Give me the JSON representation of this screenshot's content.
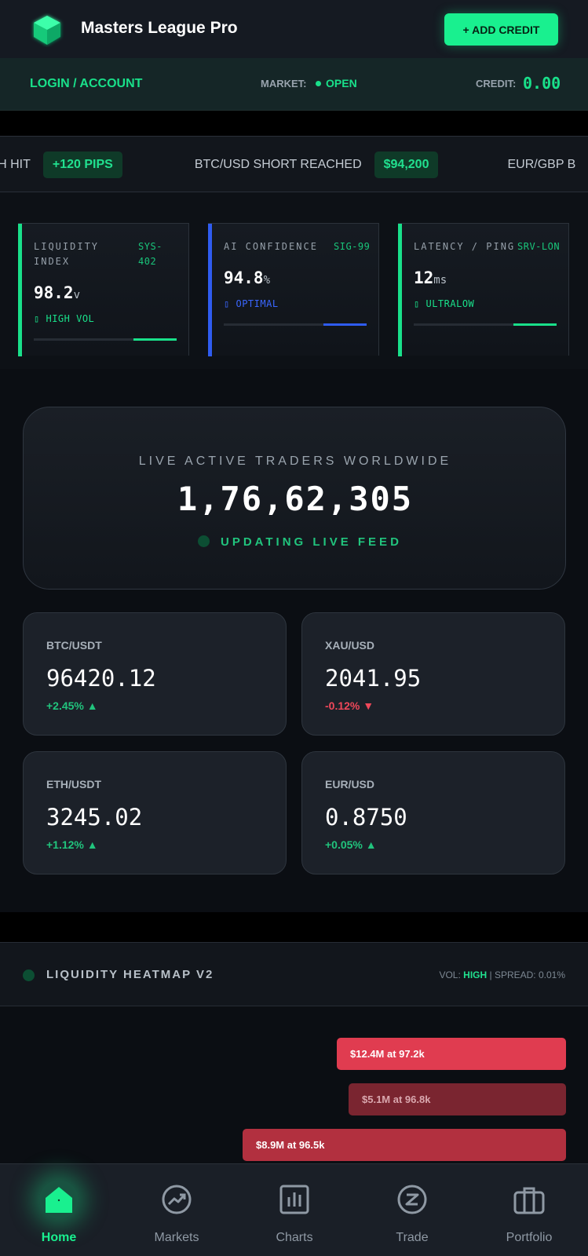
{
  "header": {
    "title": "Masters League Pro",
    "add_credit_label": "+ ADD CREDIT",
    "logo_icon": "cube-icon",
    "brand_color": "#19f08f"
  },
  "subbar": {
    "login_label": "LOGIN / ACCOUNT",
    "market_label": "MARKET:",
    "market_status": "OPEN",
    "credit_label": "CREDIT:",
    "credit_value": "0.00"
  },
  "ticker": {
    "items": [
      {
        "text": "ISH HIT",
        "badge": "+120 PIPS"
      },
      {
        "text": "BTC/USD SHORT REACHED",
        "badge": "$94,200"
      },
      {
        "text": "EUR/GBP B",
        "badge": ""
      }
    ]
  },
  "stats": [
    {
      "label": "LIQUIDITY INDEX",
      "code": "SYS-402",
      "value": "98.2",
      "unit": "v",
      "status": "HIGH VOL",
      "status_icon": "signal-icon",
      "level": 0.3,
      "accent": "#19e08a"
    },
    {
      "label": "AI CONFIDENCE",
      "code": "SIG-99",
      "value": "94.8",
      "unit": "%",
      "status": "OPTIMAL",
      "status_icon": "signal-icon",
      "level": 0.3,
      "accent": "#2f5cf0"
    },
    {
      "label": "LATENCY / PING",
      "code": "SRV-LON",
      "value": "12",
      "unit": "ms",
      "status": "ULTRALOW",
      "status_icon": "signal-icon",
      "level": 0.3,
      "accent": "#19e08a"
    }
  ],
  "traders": {
    "label": "LIVE ACTIVE TRADERS WORLDWIDE",
    "value": "1,76,62,305",
    "status": "UPDATING LIVE FEED"
  },
  "prices": [
    {
      "pair": "BTC/USDT",
      "price": "96420.12",
      "change": "+2.45% ▲",
      "direction": "up"
    },
    {
      "pair": "XAU/USD",
      "price": "2041.95",
      "change": "-0.12% ▼",
      "direction": "down"
    },
    {
      "pair": "ETH/USDT",
      "price": "3245.02",
      "change": "+1.12% ▲",
      "direction": "up"
    },
    {
      "pair": "EUR/USD",
      "price": "0.8750",
      "change": "+0.05% ▲",
      "direction": "up"
    }
  ],
  "heatmap": {
    "title": "LIQUIDITY HEATMAP V2",
    "vol_label": "VOL:",
    "vol_value": "HIGH",
    "spread_label": "| SPREAD: 0.01%",
    "bars": [
      {
        "label": "$12.4M at 97.2k",
        "amount_m": 12.4,
        "color": "#e03c50"
      },
      {
        "label": "$5.1M at 96.8k",
        "amount_m": 5.1,
        "color": "#7a2530"
      },
      {
        "label": "$8.9M at 96.5k",
        "amount_m": 8.9,
        "color": "#b2303f"
      }
    ]
  },
  "nav": {
    "items": [
      {
        "label": "Home",
        "icon": "home-icon",
        "active": true
      },
      {
        "label": "Markets",
        "icon": "trending-icon",
        "active": false
      },
      {
        "label": "Charts",
        "icon": "bar-chart-icon",
        "active": false
      },
      {
        "label": "Trade",
        "icon": "exchange-icon",
        "active": false
      },
      {
        "label": "Portfolio",
        "icon": "briefcase-icon",
        "active": false
      }
    ]
  }
}
